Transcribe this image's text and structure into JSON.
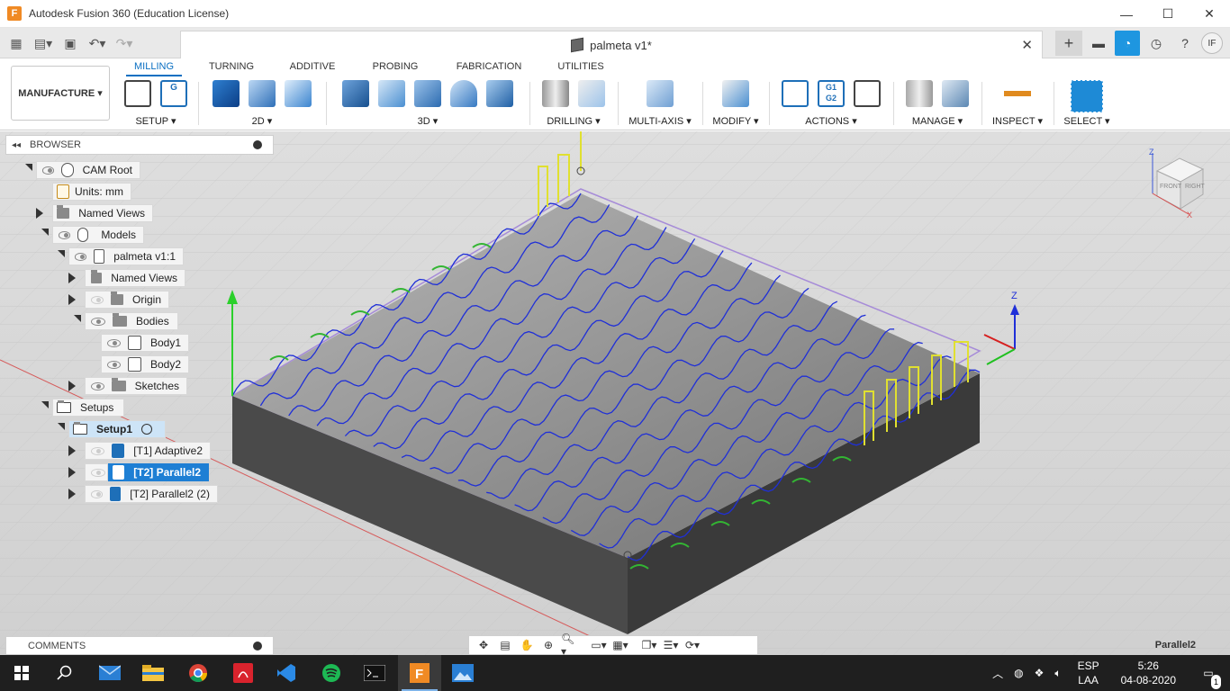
{
  "window": {
    "title": "Autodesk Fusion 360 (Education License)",
    "logo": "F",
    "minimize": "—",
    "maximize": "☐",
    "close": "✕"
  },
  "document": {
    "name": "palmeta v1*",
    "user_initials": "IF"
  },
  "ribbon": {
    "workspace": "MANUFACTURE ▾",
    "tabs": [
      "MILLING",
      "TURNING",
      "ADDITIVE",
      "PROBING",
      "FABRICATION",
      "UTILITIES"
    ],
    "active_tab": "MILLING",
    "groups": [
      "SETUP ▾",
      "2D ▾",
      "3D ▾",
      "DRILLING ▾",
      "MULTI-AXIS ▾",
      "MODIFY ▾",
      "ACTIONS ▾",
      "MANAGE ▾",
      "INSPECT ▾",
      "SELECT ▾"
    ],
    "g1g2_text": "G1\nG2"
  },
  "browser": {
    "title": "BROWSER",
    "nodes": {
      "cam_root": "CAM Root",
      "units": "Units: mm",
      "named_views": "Named Views",
      "models": "Models",
      "component": "palmeta v1:1",
      "named_views_2": "Named Views",
      "origin": "Origin",
      "bodies": "Bodies",
      "body1": "Body1",
      "body2": "Body2",
      "sketches": "Sketches",
      "setups": "Setups",
      "setup1": "Setup1",
      "op1": "[T1] Adaptive2",
      "op2": "[T2] Parallel2",
      "op3": "[T2] Parallel2 (2)"
    }
  },
  "comments": {
    "title": "COMMENTS"
  },
  "viewcube": {
    "front": "FRONT",
    "right": "RIGHT",
    "z": "Z",
    "x": "X"
  },
  "triad": {
    "z": "Z"
  },
  "status": {
    "operation": "Parallel2"
  },
  "taskbar": {
    "language": "ESP",
    "layout": "LAA",
    "time": "5:26",
    "date": "04-08-2020",
    "notifications": "1"
  },
  "colors": {
    "accent": "#0a6fc2",
    "toolpath": "#1f2fd8",
    "selected": "#1e7fd4",
    "taskbar": "#1f1f1f"
  }
}
